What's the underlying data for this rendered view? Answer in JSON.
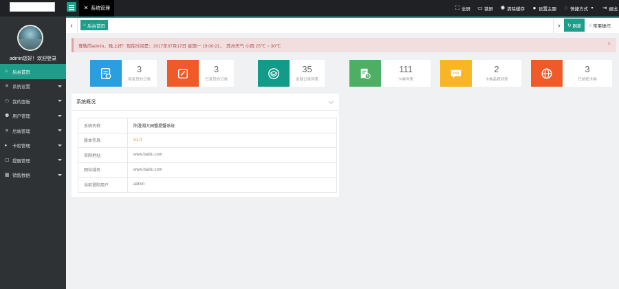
{
  "header": {
    "system_tab": "系统管理",
    "actions": [
      {
        "icon": "fullscreen-icon",
        "label": "全屏"
      },
      {
        "icon": "lock-icon",
        "label": "锁屏"
      },
      {
        "icon": "clear-cache-icon",
        "label": "清除缓存"
      },
      {
        "icon": "theme-icon",
        "label": "设置主题"
      },
      {
        "icon": "quick-icon",
        "label": "快捷方式"
      },
      {
        "icon": "logout-icon",
        "label": "退出"
      }
    ]
  },
  "sidebar": {
    "welcome": "admin您好！欢迎登录",
    "items": [
      {
        "icon": "home-icon",
        "label": "后台首页",
        "active": true
      },
      {
        "icon": "settings-icon",
        "label": "系统设置"
      },
      {
        "icon": "user-icon",
        "label": "我的面板"
      },
      {
        "icon": "users-icon",
        "label": "用户管理"
      },
      {
        "icon": "tools-icon",
        "label": "后端管理"
      },
      {
        "icon": "card-icon",
        "label": "卡密管理"
      },
      {
        "icon": "doc-icon",
        "label": "提醒管理"
      },
      {
        "icon": "grid-icon",
        "label": "销售数据"
      }
    ]
  },
  "tabbar": {
    "home_tab": "后台首页",
    "refresh": "刷新",
    "common_ops": "常用操作"
  },
  "alert": {
    "text": "尊敬的admin，晚上好！现在时间是：2017年07月17日 星期一 19:00:21，",
    "weather": "苏州天气 小雨 25℃ ~ 30℃",
    "close": "×"
  },
  "stats": [
    {
      "value": "3",
      "label": "待发货的订单",
      "color": "#2a9fe0",
      "icon": "clipboard-icon"
    },
    {
      "value": "3",
      "label": "已发货的订单",
      "color": "#f05a28",
      "icon": "edit-icon"
    },
    {
      "value": "35",
      "label": "全部订单列表",
      "color": "#139b89",
      "icon": "layers-icon"
    },
    {
      "value": "111",
      "label": "卡券列表",
      "color": "#4caf64",
      "icon": "document-clock-icon"
    },
    {
      "value": "2",
      "label": "卡卷品规列表",
      "color": "#f8b624",
      "icon": "message-icon"
    },
    {
      "value": "3",
      "label": "已核销卡券",
      "color": "#f05a28",
      "icon": "globe-icon"
    }
  ],
  "panel": {
    "title": "系统概况",
    "rows": [
      {
        "key": "系统名称:",
        "value": "阳澄湖大闸蟹提蟹系统"
      },
      {
        "key": "版本信息:",
        "value": "V1.0"
      },
      {
        "key": "官网地址:",
        "value": "www.baidu.com"
      },
      {
        "key": "网站域名:",
        "value": "www.baidu.com"
      },
      {
        "key": "当前登陆用户:",
        "value": "admin"
      }
    ]
  },
  "colors": {
    "accent": "#1e9e8a",
    "topbar": "#1f2124",
    "sidebar": "#2f3234"
  }
}
